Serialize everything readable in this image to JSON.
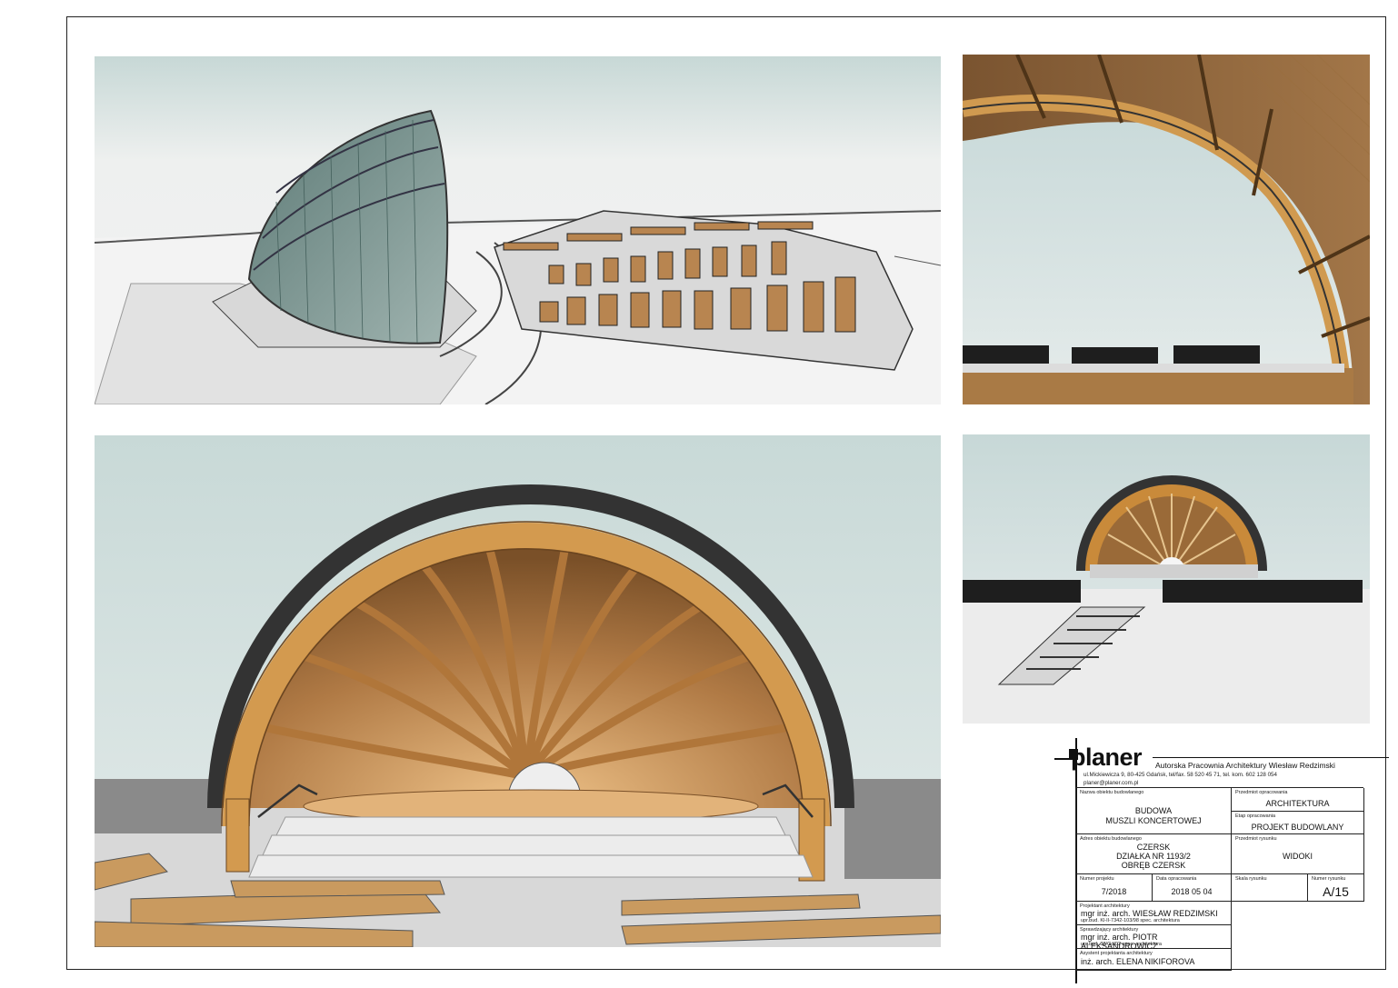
{
  "logo": {
    "text": "planer"
  },
  "office": {
    "name": "Autorska Pracownia Architektury Wiesław Redzimski",
    "address": "ul.Mickiewicza 9, 80-425 Gdańsk, tel/fax. 58 520 45 71, tel. kom. 602 128 054",
    "email": "planer@planer.com.pl"
  },
  "title_block": {
    "object_name_label": "Nazwa obiektu budowlanego",
    "object_name_line1": "BUDOWA",
    "object_name_line2": "MUSZLI KONCERTOWEJ",
    "subject_label": "Przedmiot opracowania",
    "subject_value": "ARCHITEKTURA",
    "stage_label": "Etap opracowania",
    "stage_value": "PROJEKT BUDOWLANY",
    "address_label": "Adres obiektu budowlanego",
    "address_line1": "CZERSK",
    "address_line2": "DZIAŁKA NR 1193/2",
    "address_line3": "OBRĘB CZERSK",
    "drawing_subject_label": "Przedmiot rysunku",
    "drawing_subject_value": "WIDOKI",
    "project_no_label": "Numer projektu",
    "project_no_value": "7/2018",
    "date_label": "Data opracowania",
    "date_value": "2018 05 04",
    "scale_label": "Skala rysunku",
    "scale_value": "",
    "sheet_no_label": "Numer rysunku",
    "sheet_no_value": "A/15",
    "designer_label": "Projektant architektury",
    "designer_name": "mgr inż. arch. WIESŁAW REDZIMSKI",
    "designer_cert": "upr.bud. Kl-II-7342-103/98 spec. architektura",
    "checker_label": "Sprawdzający architektury",
    "checker_name": "mgr inż. arch. PIOTR ALEKSANDROWICZ",
    "checker_cert": "upr.bud. 38/Gd/02 spec. architektura",
    "assistant_label": "Asystent projektanta architektury",
    "assistant_name": "inż. arch. ELENA NIKIFOROVA"
  },
  "colors": {
    "wood": "#c98a3a",
    "wood_dark": "#8a5a28",
    "sky": "#c9d9d8",
    "shell_glass": "#6f8a86"
  }
}
